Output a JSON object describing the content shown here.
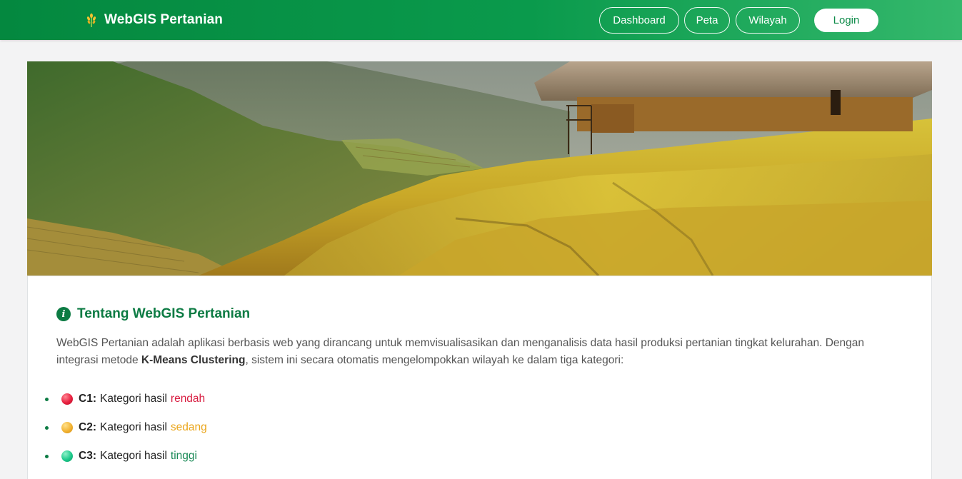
{
  "navbar": {
    "brand": "WebGIS Pertanian",
    "links": [
      "Dashboard",
      "Peta",
      "Wilayah"
    ],
    "login": "Login"
  },
  "about": {
    "title": "Tentang WebGIS Pertanian",
    "desc_part1": "WebGIS Pertanian adalah aplikasi berbasis web yang dirancang untuk memvisualisasikan dan menganalisis data hasil produksi pertanian tingkat kelurahan. Dengan integrasi metode ",
    "desc_bold": "K-Means Clustering",
    "desc_part2": ", sistem ini secara otomatis mengelompokkan wilayah ke dalam tiga kategori:",
    "categories": [
      {
        "code": "C1:",
        "text": "Kategori hasil",
        "level": "rendah",
        "color": "#d81b3f"
      },
      {
        "code": "C2:",
        "text": "Kategori hasil",
        "level": "sedang",
        "color": "#eaa51a"
      },
      {
        "code": "C3:",
        "text": "Kategori hasil",
        "level": "tinggi",
        "color": "#1a8a57"
      }
    ]
  },
  "colors": {
    "brand_green": "#0c7b43",
    "navbar_start": "#04883f",
    "navbar_end": "#34b86c"
  },
  "icons": {
    "brand": "rice-plant-icon",
    "title": "info-circle-icon"
  }
}
